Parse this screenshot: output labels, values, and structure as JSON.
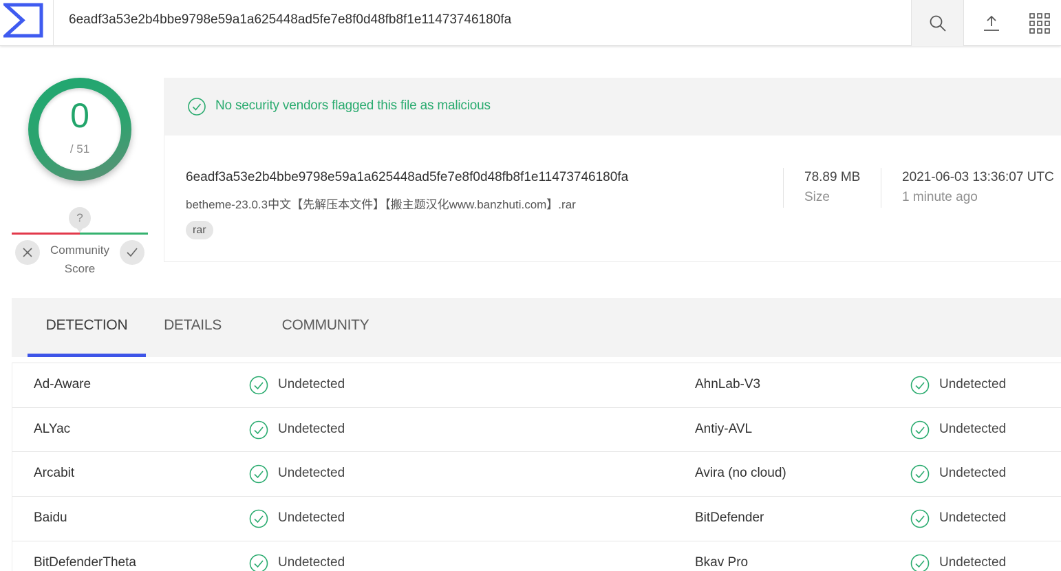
{
  "header": {
    "search_value": "6eadf3a53e2b4bbe9798e59a1a625448ad5fe7e8f0d48fb8f1e11473746180fa",
    "logo_icon": "sigma-logo-icon",
    "search_icon": "search-icon",
    "upload_icon": "upload-icon",
    "apps_icon": "apps-grid-icon"
  },
  "score": {
    "detections": "0",
    "total": "/ 51",
    "ring_color": "#2aa56d"
  },
  "community": {
    "question": "?",
    "label_line1": "Community",
    "label_line2": "Score"
  },
  "banner": {
    "message": "No security vendors flagged this file as malicious",
    "color": "#2aab6f"
  },
  "file": {
    "hash": "6eadf3a53e2b4bbe9798e59a1a625448ad5fe7e8f0d48fb8f1e11473746180fa",
    "name": "betheme-23.0.3中文【先解压本文件】【搬主题汉化www.banzhuti.com】.rar",
    "tag": "rar",
    "size_value": "78.89 MB",
    "size_label": "Size",
    "date_value": "2021-06-03 13:36:07 UTC",
    "date_label": "1 minute ago"
  },
  "tabs": [
    {
      "label": "DETECTION"
    },
    {
      "label": "DETAILS"
    },
    {
      "label": "COMMUNITY"
    }
  ],
  "accent_color": "#3d54e8",
  "results": [
    {
      "left_engine": "Ad-Aware",
      "left_status": "Undetected",
      "right_engine": "AhnLab-V3",
      "right_status": "Undetected"
    },
    {
      "left_engine": "ALYac",
      "left_status": "Undetected",
      "right_engine": "Antiy-AVL",
      "right_status": "Undetected"
    },
    {
      "left_engine": "Arcabit",
      "left_status": "Undetected",
      "right_engine": "Avira (no cloud)",
      "right_status": "Undetected"
    },
    {
      "left_engine": "Baidu",
      "left_status": "Undetected",
      "right_engine": "BitDefender",
      "right_status": "Undetected"
    },
    {
      "left_engine": "BitDefenderTheta",
      "left_status": "Undetected",
      "right_engine": "Bkav Pro",
      "right_status": "Undetected"
    }
  ]
}
